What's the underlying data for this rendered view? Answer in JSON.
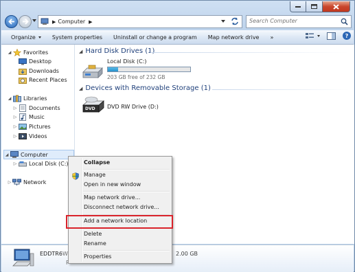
{
  "address_bar": {
    "crumb": "Computer",
    "search_placeholder": "Search Computer"
  },
  "command_bar": {
    "items": [
      "Organize",
      "System properties",
      "Uninstall or change a program",
      "Map network drive",
      "»"
    ]
  },
  "nav_pane": {
    "favorites": "Favorites",
    "favorites_items": [
      "Desktop",
      "Downloads",
      "Recent Places"
    ],
    "libraries": "Libraries",
    "libraries_items": [
      "Documents",
      "Music",
      "Pictures",
      "Videos"
    ],
    "computer": "Computer",
    "computer_items": [
      "Local Disk (C:)"
    ],
    "network": "Network"
  },
  "content": {
    "hdd_header": "Hard Disk Drives (1)",
    "local_disk": {
      "label": "Local Disk (C:)",
      "free": "203 GB free of 232 GB",
      "used_fraction": 0.125
    },
    "removable_header": "Devices with Removable Storage (1)",
    "dvd": {
      "label": "DVD RW Drive (D:)",
      "icon_text": "DVD"
    }
  },
  "details": {
    "name": "EDDTR6",
    "wo": "Wo",
    "p": "P",
    "memory": "2.00 GB"
  },
  "context_menu": {
    "items": [
      "Collapse",
      "Manage",
      "Open in new window",
      "Map network drive...",
      "Disconnect network drive...",
      "Add a network location",
      "Delete",
      "Rename",
      "Properties"
    ],
    "highlighted": "Add a network location"
  },
  "colors": {
    "highlight_border": "#d9222a",
    "progress_fill": "#2691cc",
    "header_text": "#1e3f7a"
  }
}
